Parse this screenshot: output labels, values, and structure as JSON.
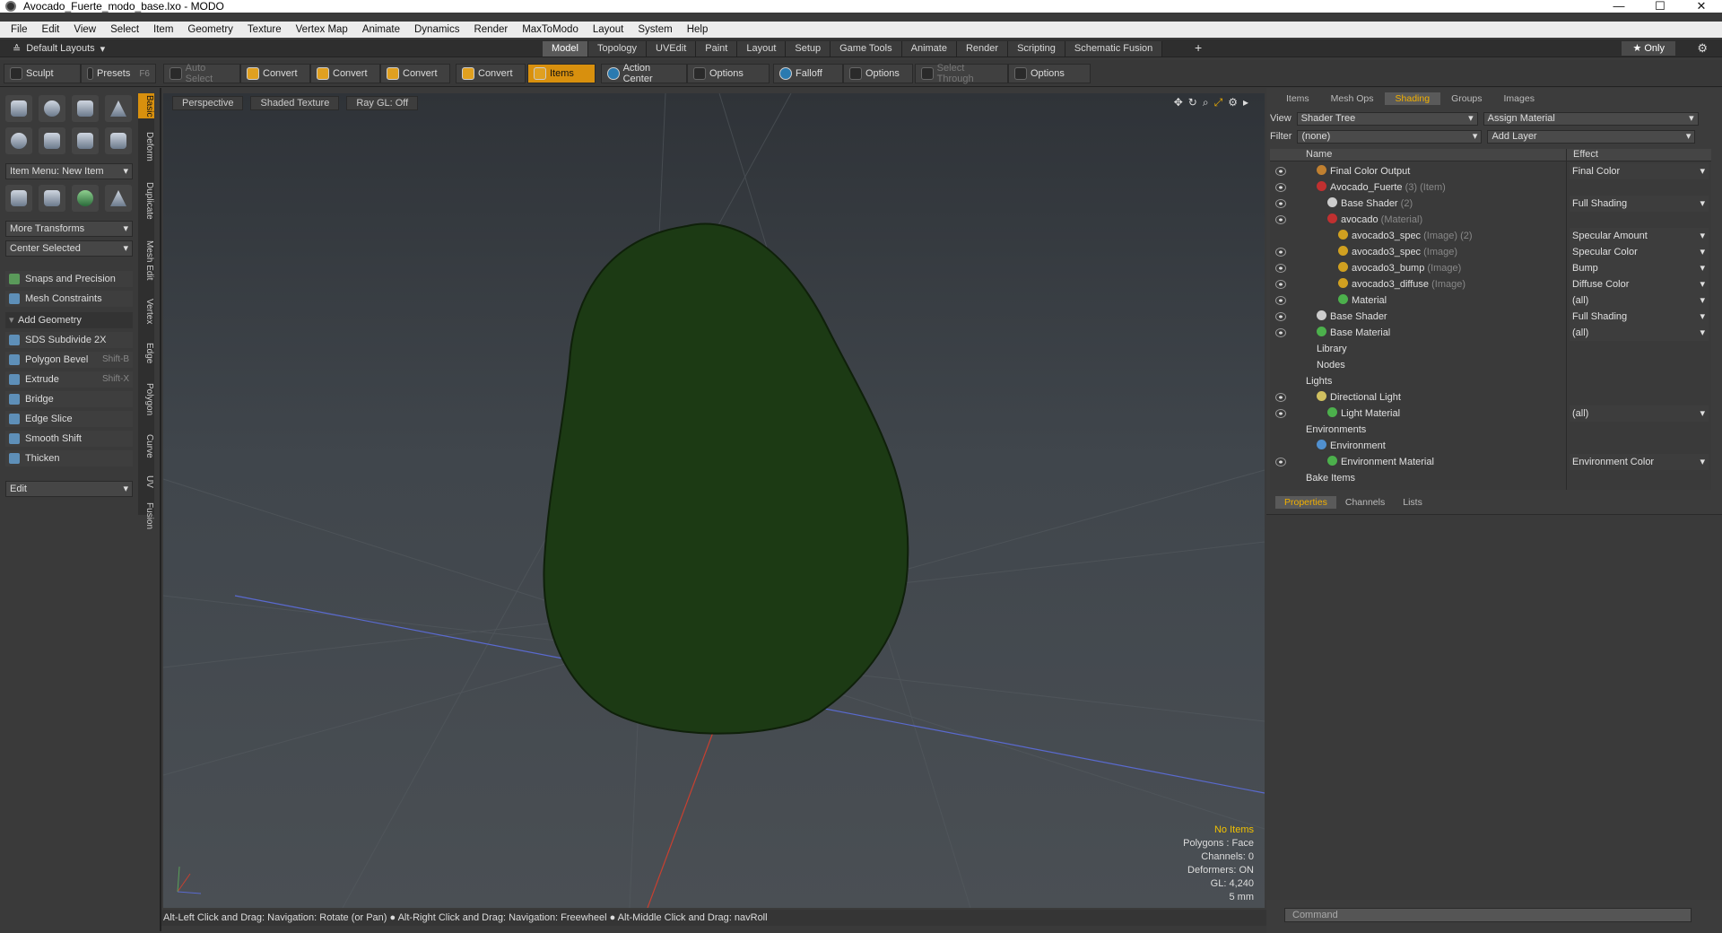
{
  "window": {
    "title": "Avocado_Fuerte_modo_base.lxo - MODO",
    "min": "—",
    "max": "☐",
    "close": "✕"
  },
  "menu": [
    "File",
    "Edit",
    "View",
    "Select",
    "Item",
    "Geometry",
    "Texture",
    "Vertex Map",
    "Animate",
    "Dynamics",
    "Render",
    "MaxToModo",
    "Layout",
    "System",
    "Help"
  ],
  "layout": {
    "default_layouts": "Default Layouts",
    "tabs": [
      "Model",
      "Topology",
      "UVEdit",
      "Paint",
      "Layout",
      "Setup",
      "Game Tools",
      "Animate",
      "Render",
      "Scripting",
      "Schematic Fusion"
    ],
    "active_tab": "Model",
    "plus": "+",
    "only": "★ Only"
  },
  "toolbar": {
    "sculpt": "Sculpt",
    "presets": "Presets",
    "presets_key": "F6",
    "auto_select": "Auto Select",
    "convert1": "Convert",
    "convert2": "Convert",
    "convert3": "Convert",
    "convert4": "Convert",
    "items": "Items",
    "action_center": "Action Center",
    "options1": "Options",
    "falloff": "Falloff",
    "options2": "Options",
    "select_through": "Select Through",
    "options3": "Options"
  },
  "left": {
    "vtabs": [
      "Basic",
      "Deform",
      "Duplicate",
      "Mesh Edit",
      "Vertex",
      "Edge",
      "Polygon",
      "Curve",
      "UV",
      "Fusion"
    ],
    "item_menu": "Item Menu: New Item",
    "more_transforms": "More Transforms",
    "center_selected": "Center Selected",
    "snaps": "Snaps and Precision",
    "mesh_constraints": "Mesh Constraints",
    "add_geometry": "Add Geometry",
    "tools": [
      {
        "label": "SDS Subdivide 2X",
        "key": ""
      },
      {
        "label": "Polygon Bevel",
        "key": "Shift-B"
      },
      {
        "label": "Extrude",
        "key": "Shift-X"
      },
      {
        "label": "Bridge",
        "key": ""
      },
      {
        "label": "Edge Slice",
        "key": ""
      },
      {
        "label": "Smooth Shift",
        "key": ""
      },
      {
        "label": "Thicken",
        "key": ""
      }
    ],
    "edit": "Edit"
  },
  "viewport": {
    "perspective": "Perspective",
    "shaded": "Shaded Texture",
    "raygl": "Ray GL: Off",
    "stats": [
      "No Items",
      "Polygons : Face",
      "Channels: 0",
      "Deformers: ON",
      "GL: 4,240",
      "5 mm"
    ],
    "model_color": "#1c3a14"
  },
  "statusbar": "Alt-Left Click and Drag: Navigation: Rotate (or Pan) ● Alt-Right Click and Drag: Navigation: Freewheel ● Alt-Middle Click and Drag: navRoll",
  "right": {
    "tabs": [
      "Items",
      "Mesh Ops",
      "Shading",
      "Groups",
      "Images"
    ],
    "active_tab": "Shading",
    "view_label": "View",
    "view_value": "Shader Tree",
    "assign_material": "Assign Material",
    "filter_label": "Filter",
    "filter_value": "(none)",
    "add_layer": "Add Layer",
    "col_name": "Name",
    "col_effect": "Effect",
    "rows": [
      {
        "name": "Final Color Output",
        "sub": "",
        "effect": "Final Color",
        "indent": 1,
        "eye": true,
        "ball": "#c08030",
        "dd": true
      },
      {
        "name": "Avocado_Fuerte",
        "sub": "(3) (Item)",
        "effect": "",
        "indent": 1,
        "eye": true,
        "ball": "#c03030",
        "dd": false
      },
      {
        "name": "Base Shader",
        "sub": "(2)",
        "effect": "Full Shading",
        "indent": 2,
        "eye": true,
        "ball": "#cccccc",
        "dd": true
      },
      {
        "name": "avocado",
        "sub": "(Material)",
        "effect": "",
        "indent": 2,
        "eye": true,
        "ball": "#c03030",
        "dd": false
      },
      {
        "name": "avocado3_spec",
        "sub": "(Image) (2)",
        "effect": "Specular Amount",
        "indent": 3,
        "eye": false,
        "ball": "#d0a020",
        "dd": true
      },
      {
        "name": "avocado3_spec",
        "sub": "(Image)",
        "effect": "Specular Color",
        "indent": 3,
        "eye": true,
        "ball": "#d0a020",
        "dd": true
      },
      {
        "name": "avocado3_bump",
        "sub": "(Image)",
        "effect": "Bump",
        "indent": 3,
        "eye": true,
        "ball": "#d0a020",
        "dd": true
      },
      {
        "name": "avocado3_diffuse",
        "sub": "(Image)",
        "effect": "Diffuse Color",
        "indent": 3,
        "eye": true,
        "ball": "#d0a020",
        "dd": true
      },
      {
        "name": "Material",
        "sub": "",
        "effect": "(all)",
        "indent": 3,
        "eye": true,
        "ball": "#4cb04c",
        "dd": true
      },
      {
        "name": "Base Shader",
        "sub": "",
        "effect": "Full Shading",
        "indent": 1,
        "eye": true,
        "ball": "#cccccc",
        "dd": true
      },
      {
        "name": "Base Material",
        "sub": "",
        "effect": "(all)",
        "indent": 1,
        "eye": true,
        "ball": "#4cb04c",
        "dd": true
      },
      {
        "name": "Library",
        "sub": "",
        "effect": "",
        "indent": 1,
        "eye": false,
        "ball": "",
        "dd": false
      },
      {
        "name": "Nodes",
        "sub": "",
        "effect": "",
        "indent": 1,
        "eye": false,
        "ball": "",
        "dd": false
      },
      {
        "name": "Lights",
        "sub": "",
        "effect": "",
        "indent": 0,
        "eye": false,
        "ball": "",
        "dd": false
      },
      {
        "name": "Directional Light",
        "sub": "",
        "effect": "",
        "indent": 1,
        "eye": true,
        "ball": "#d0c060",
        "dd": false
      },
      {
        "name": "Light Material",
        "sub": "",
        "effect": "(all)",
        "indent": 2,
        "eye": true,
        "ball": "#4cb04c",
        "dd": true
      },
      {
        "name": "Environments",
        "sub": "",
        "effect": "",
        "indent": 0,
        "eye": false,
        "ball": "",
        "dd": false
      },
      {
        "name": "Environment",
        "sub": "",
        "effect": "",
        "indent": 1,
        "eye": false,
        "ball": "#5090d0",
        "dd": false
      },
      {
        "name": "Environment Material",
        "sub": "",
        "effect": "Environment Color",
        "indent": 2,
        "eye": true,
        "ball": "#4cb04c",
        "dd": true
      },
      {
        "name": "Bake Items",
        "sub": "",
        "effect": "",
        "indent": 0,
        "eye": false,
        "ball": "",
        "dd": false
      }
    ],
    "ptabs": [
      "Properties",
      "Channels",
      "Lists"
    ],
    "command_placeholder": "Command"
  }
}
